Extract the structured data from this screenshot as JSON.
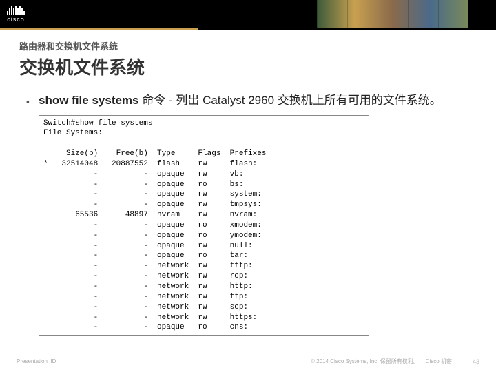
{
  "logo_text": "cisco",
  "header": {
    "subtitle": "路由器和交换机文件系统",
    "title": "交换机文件系统"
  },
  "bullet": {
    "cmd": "show file systems",
    "rest": " 命令 - 列出 Catalyst 2960 交换机上所有可用的文件系统。"
  },
  "terminal": {
    "prompt": "Switch#",
    "command": "show file systems",
    "heading": "File Systems:",
    "cols": [
      "Size(b)",
      "Free(b)",
      "Type",
      "Flags",
      "Prefixes"
    ],
    "rows": [
      {
        "mark": "*",
        "size": "32514048",
        "free": "20887552",
        "type": "flash",
        "flags": "rw",
        "prefix": "flash:"
      },
      {
        "mark": "",
        "size": "-",
        "free": "-",
        "type": "opaque",
        "flags": "rw",
        "prefix": "vb:"
      },
      {
        "mark": "",
        "size": "-",
        "free": "-",
        "type": "opaque",
        "flags": "ro",
        "prefix": "bs:"
      },
      {
        "mark": "",
        "size": "-",
        "free": "-",
        "type": "opaque",
        "flags": "rw",
        "prefix": "system:"
      },
      {
        "mark": "",
        "size": "-",
        "free": "-",
        "type": "opaque",
        "flags": "rw",
        "prefix": "tmpsys:"
      },
      {
        "mark": "",
        "size": "65536",
        "free": "48897",
        "type": "nvram",
        "flags": "rw",
        "prefix": "nvram:"
      },
      {
        "mark": "",
        "size": "-",
        "free": "-",
        "type": "opaque",
        "flags": "ro",
        "prefix": "xmodem:"
      },
      {
        "mark": "",
        "size": "-",
        "free": "-",
        "type": "opaque",
        "flags": "ro",
        "prefix": "ymodem:"
      },
      {
        "mark": "",
        "size": "-",
        "free": "-",
        "type": "opaque",
        "flags": "rw",
        "prefix": "null:"
      },
      {
        "mark": "",
        "size": "-",
        "free": "-",
        "type": "opaque",
        "flags": "ro",
        "prefix": "tar:"
      },
      {
        "mark": "",
        "size": "-",
        "free": "-",
        "type": "network",
        "flags": "rw",
        "prefix": "tftp:"
      },
      {
        "mark": "",
        "size": "-",
        "free": "-",
        "type": "network",
        "flags": "rw",
        "prefix": "rcp:"
      },
      {
        "mark": "",
        "size": "-",
        "free": "-",
        "type": "network",
        "flags": "rw",
        "prefix": "http:"
      },
      {
        "mark": "",
        "size": "-",
        "free": "-",
        "type": "network",
        "flags": "rw",
        "prefix": "ftp:"
      },
      {
        "mark": "",
        "size": "-",
        "free": "-",
        "type": "network",
        "flags": "rw",
        "prefix": "scp:"
      },
      {
        "mark": "",
        "size": "-",
        "free": "-",
        "type": "network",
        "flags": "rw",
        "prefix": "https:"
      },
      {
        "mark": "",
        "size": "-",
        "free": "-",
        "type": "opaque",
        "flags": "ro",
        "prefix": "cns:"
      }
    ]
  },
  "footer": {
    "pid": "Presentation_ID",
    "copyright": "© 2014 Cisco Systems, Inc. 保留所有权利。",
    "confidential": "Cisco 机密",
    "page": "43"
  }
}
